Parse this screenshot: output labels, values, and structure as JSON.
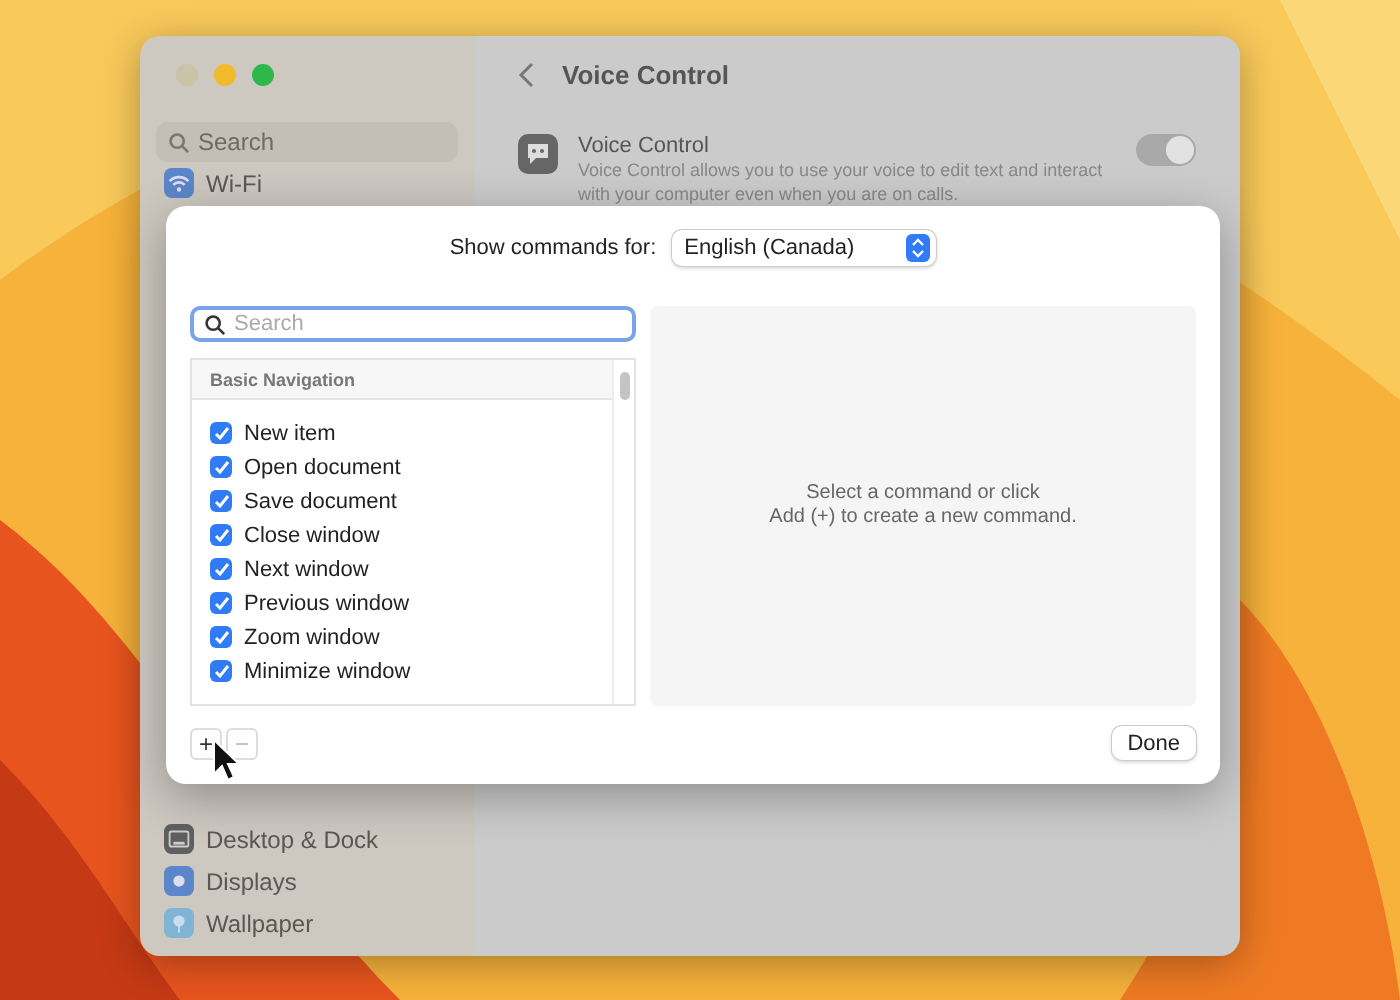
{
  "window": {
    "title": "Voice Control"
  },
  "sidebar": {
    "search_placeholder": "Search",
    "items": [
      {
        "label": "Wi-Fi",
        "kind": "wifi"
      },
      {
        "label": "Desktop & Dock",
        "kind": "dock"
      },
      {
        "label": "Displays",
        "kind": "display"
      },
      {
        "label": "Wallpaper",
        "kind": "wallpaper"
      }
    ]
  },
  "setting": {
    "title": "Voice Control",
    "description": "Voice Control allows you to use your voice to edit text and interact with your computer even when you are on calls.",
    "on": true
  },
  "sheet": {
    "label": "Show commands for:",
    "language": "English (Canada)",
    "search_placeholder": "Search",
    "group": "Basic Navigation",
    "commands": [
      {
        "label": "New item",
        "checked": true
      },
      {
        "label": "Open document",
        "checked": true
      },
      {
        "label": "Save document",
        "checked": true
      },
      {
        "label": "Close window",
        "checked": true
      },
      {
        "label": "Next window",
        "checked": true
      },
      {
        "label": "Previous window",
        "checked": true
      },
      {
        "label": "Zoom window",
        "checked": true
      },
      {
        "label": "Minimize window",
        "checked": true
      }
    ],
    "message": [
      "Select a command or click",
      "Add (+) to create a new command."
    ],
    "add": {
      "label": "+",
      "disabled": false
    },
    "remove": {
      "label": "−",
      "disabled": true
    },
    "done": "Done"
  }
}
